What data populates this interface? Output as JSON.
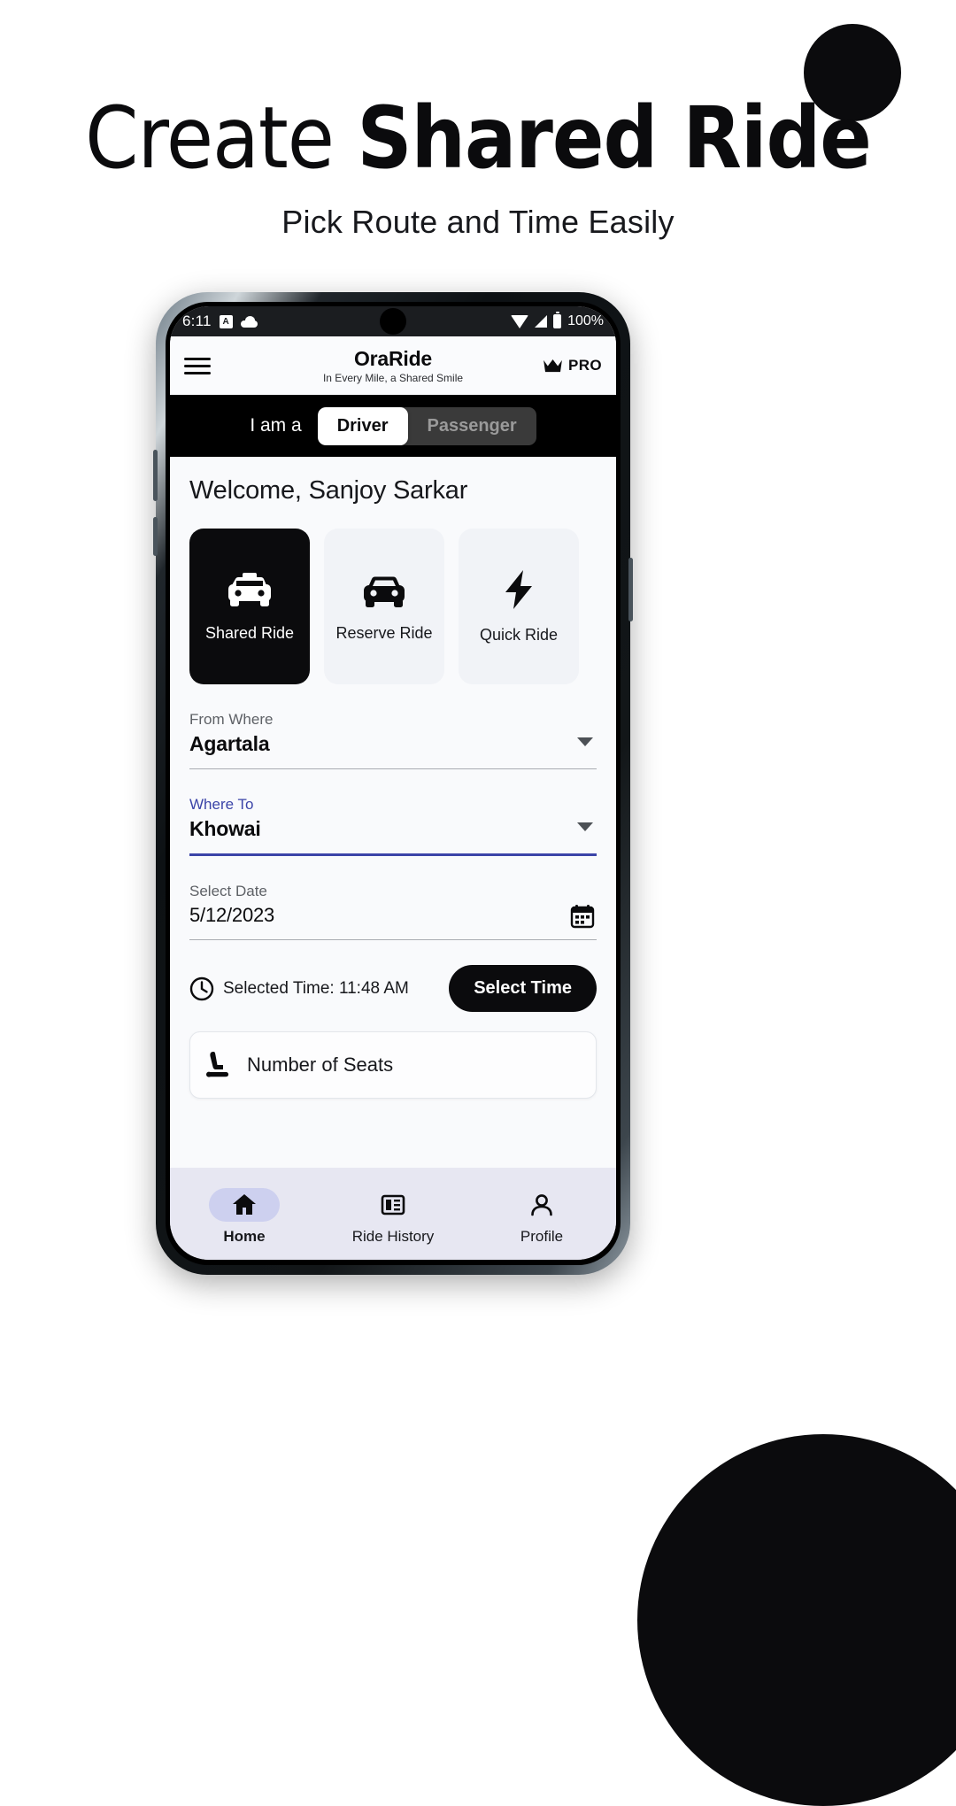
{
  "promo": {
    "title_thin": "Create ",
    "title_bold": "Shared Ride",
    "subtitle": "Pick Route and Time Easily"
  },
  "statusbar": {
    "time": "6:11",
    "a_badge": "A",
    "cloud_icon": "cloud-icon",
    "wifi_icon": "wifi-icon",
    "signal_icon": "signal-icon",
    "battery_icon": "battery-icon",
    "battery_pct": "100%"
  },
  "appbar": {
    "menu_icon": "hamburger-menu-icon",
    "brand_name": "OraRide",
    "brand_tagline": "In Every Mile, a Shared Smile",
    "crown_icon": "crown-icon",
    "pro_label": "PRO"
  },
  "rolebar": {
    "label": "I am a",
    "options": [
      {
        "label": "Driver",
        "selected": true
      },
      {
        "label": "Passenger",
        "selected": false
      }
    ]
  },
  "main": {
    "welcome": "Welcome, Sanjoy Sarkar",
    "ride_types": [
      {
        "label": "Shared Ride",
        "icon": "taxi-icon",
        "selected": true
      },
      {
        "label": "Reserve Ride",
        "icon": "car-icon",
        "selected": false
      },
      {
        "label": "Quick Ride",
        "icon": "lightning-bolt-icon",
        "selected": false
      }
    ],
    "from_field": {
      "label": "From Where",
      "value": "Agartala",
      "focused": false
    },
    "to_field": {
      "label": "Where To",
      "value": "Khowai",
      "focused": true
    },
    "date_field": {
      "label": "Select Date",
      "value": "5/12/2023",
      "icon": "calendar-icon"
    },
    "time_row": {
      "clock_icon": "clock-icon",
      "text": "Selected Time: 11:48 AM",
      "button_label": "Select Time"
    },
    "seats_card": {
      "icon": "car-seat-icon",
      "label": "Number of Seats"
    }
  },
  "bottomnav": {
    "items": [
      {
        "label": "Home",
        "icon": "home-icon",
        "active": true
      },
      {
        "label": "Ride History",
        "icon": "list-icon",
        "active": false
      },
      {
        "label": "Profile",
        "icon": "person-icon",
        "active": false
      }
    ]
  },
  "colors": {
    "accent": "#3b44a8",
    "dark": "#0b0b0d",
    "nav_bg": "#e7e7f2"
  }
}
